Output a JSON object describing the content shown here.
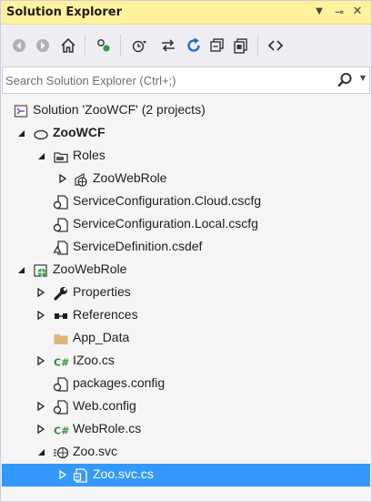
{
  "window": {
    "title": "Solution Explorer",
    "menu_glyph": "▼",
    "pin_glyph": "⊸",
    "close_glyph": "✕"
  },
  "search": {
    "placeholder": "Search Solution Explorer (Ctrl+;)"
  },
  "toolbar": {
    "buttons": [
      "back-icon",
      "forward-icon",
      "home-icon",
      "sync-active-document-icon",
      "pending-changes-filter-icon",
      "sync-icon",
      "refresh-icon",
      "collapse-all-icon",
      "show-all-files-icon",
      "view-code-icon"
    ]
  },
  "tree": {
    "solution": "Solution 'ZooWCF' (2 projects)",
    "project1": "ZooWCF",
    "roles": "Roles",
    "zoowebrole_role": "ZooWebRole",
    "svc_cloud": "ServiceConfiguration.Cloud.cscfg",
    "svc_local": "ServiceConfiguration.Local.cscfg",
    "svc_def": "ServiceDefinition.csdef",
    "project2": "ZooWebRole",
    "properties": "Properties",
    "references": "References",
    "app_data": "App_Data",
    "izoo": "IZoo.cs",
    "packages": "packages.config",
    "webconfig": "Web.config",
    "webrole": "WebRole.cs",
    "zoosvc": "Zoo.svc",
    "zoosvccs": "Zoo.svc.cs"
  },
  "colors": {
    "title_bar": "#fff29d",
    "selection": "#3399ff",
    "background": "#f5f5f5"
  }
}
